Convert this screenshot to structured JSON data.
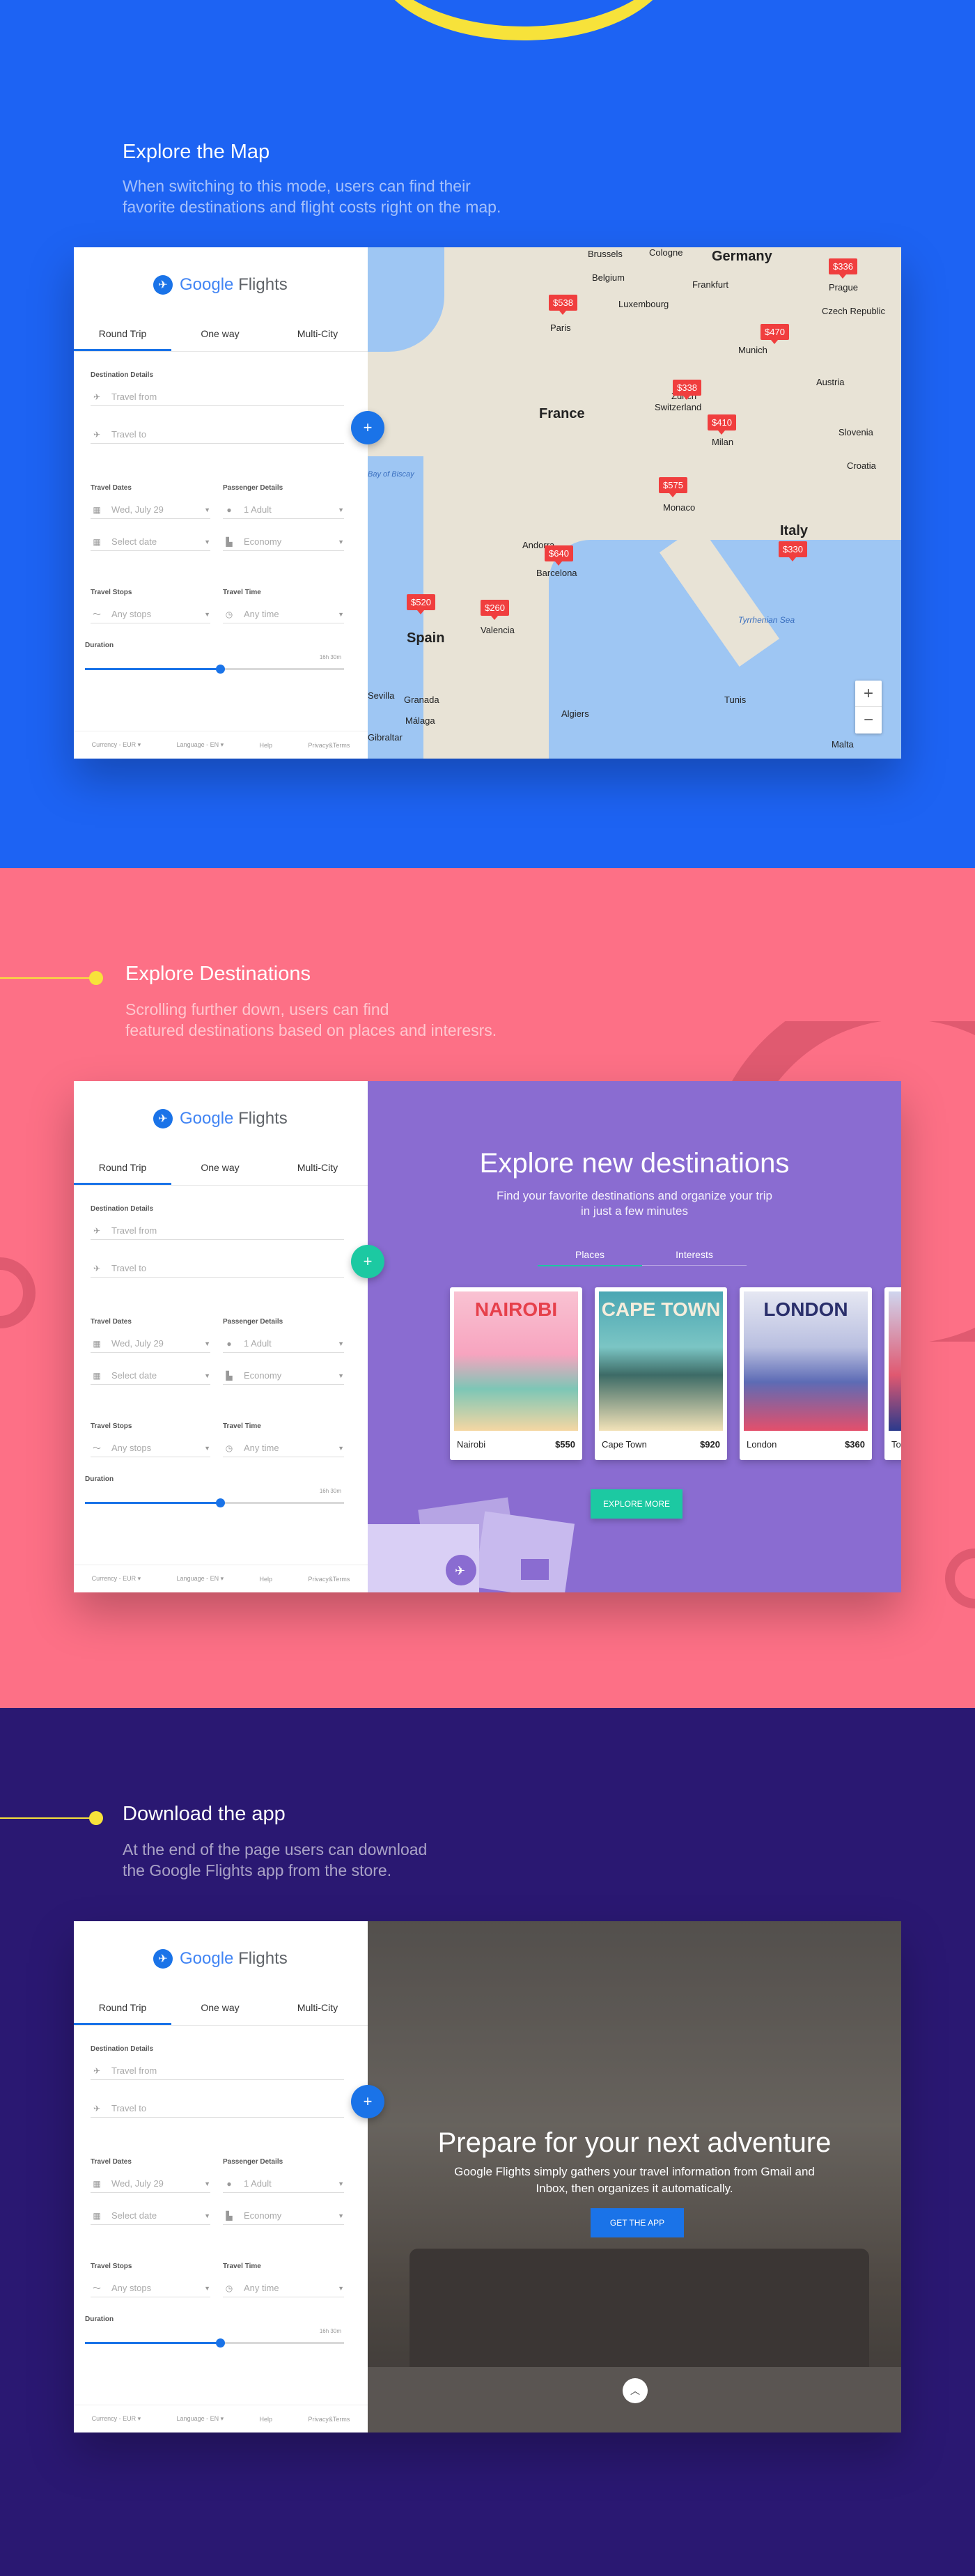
{
  "colors": {
    "section1": "#1d63f3",
    "section2": "#fd7086",
    "section3": "#2a1872",
    "accent_blue": "#1a73e8",
    "accent_teal": "#1cc9a2",
    "yellow": "#f7e23a",
    "pin_red": "#f03e3e"
  },
  "sections": {
    "map": {
      "title": "Explore the Map",
      "desc1": "When switching to this mode, users can find their",
      "desc2": "favorite destinations and flight costs right on the map."
    },
    "destinations": {
      "title": "Explore Destinations",
      "desc1": "Scrolling further down, users can find",
      "desc2": "featured destinations based on places and interesrs."
    },
    "app": {
      "title": "Download the app",
      "desc1": "At the end of the page users can download",
      "desc2": "the Google Flights app from the store."
    }
  },
  "panel": {
    "logo_google": "Google",
    "logo_flights": "Flights",
    "tabs": [
      "Round Trip",
      "One way",
      "Multi-City"
    ],
    "destination_details": "Destination Details",
    "travel_from": "Travel from",
    "travel_to": "Travel to",
    "travel_dates": "Travel Dates",
    "passenger_details": "Passenger Details",
    "date_value": "Wed, July 29",
    "select_date": "Select date",
    "adults": "1 Adult",
    "cabin": "Economy",
    "travel_stops": "Travel Stops",
    "travel_time": "Travel Time",
    "any_stops": "Any stops",
    "any_time": "Any time",
    "duration": "Duration",
    "duration_value": "16h 30m",
    "footer": [
      "Currency - EUR ▾",
      "Language - EN ▾",
      "Help",
      "Privacy&Terms"
    ]
  },
  "map": {
    "countries": [
      "Germany",
      "France",
      "Switzerland",
      "Austria",
      "Italy",
      "Spain",
      "Belgium",
      "Luxembourg",
      "Czech Republic",
      "Slovenia",
      "Croatia"
    ],
    "cities": [
      "Brussels",
      "Cologne",
      "Frankfurt",
      "Prague",
      "Paris",
      "Munich",
      "Zurich",
      "Milan",
      "Monaco",
      "Andorra",
      "Barcelona",
      "Valencia",
      "Granada",
      "Málaga",
      "Gibraltar",
      "Algiers",
      "Tunis",
      "Malta",
      "Sevilla"
    ],
    "seas": [
      "Tyrrhenian Sea",
      "Bay of Biscay"
    ],
    "prices": [
      "$538",
      "$336",
      "$470",
      "$338",
      "$410",
      "$575",
      "$640",
      "$520",
      "$260",
      "$330"
    ],
    "zoom_in": "+",
    "zoom_out": "−"
  },
  "destinations_page": {
    "title": "Explore new destinations",
    "subtitle": "Find your favorite destinations and organize your trip in just a few minutes",
    "tabs": [
      "Places",
      "Interests"
    ],
    "cards": [
      {
        "name": "Nairobi",
        "price": "$550",
        "art": "NAIROBI"
      },
      {
        "name": "Cape Town",
        "price": "$920",
        "art": "CAPE TOWN"
      },
      {
        "name": "London",
        "price": "$360",
        "art": "LONDON"
      },
      {
        "name": "To",
        "price": "",
        "art": ""
      }
    ],
    "button": "EXPLORE MORE"
  },
  "app_page": {
    "title": "Prepare for your next adventure",
    "subtitle": "Google Flights simply gathers your travel information from Gmail and Inbox, then organizes it automatically.",
    "button": "GET THE APP"
  }
}
